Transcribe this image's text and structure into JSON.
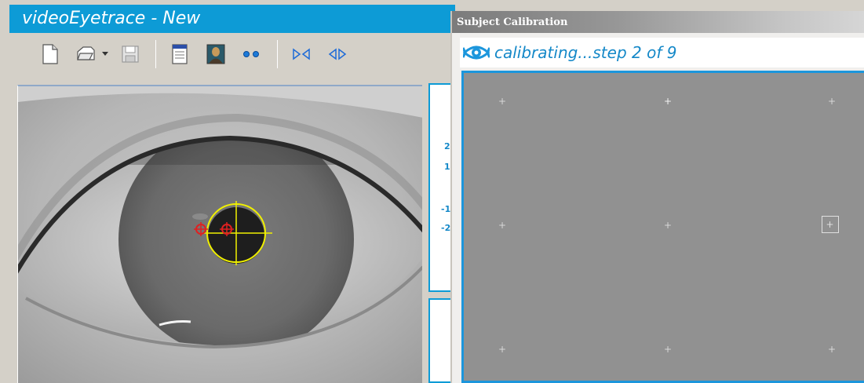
{
  "main_window": {
    "title": "videoEyetrace - New",
    "toolbar": {
      "buttons": [
        "new-file-icon",
        "open-file-icon",
        "dropdown-arrow-icon",
        "save-file-icon",
        "document-icon",
        "image-icon",
        "two-dots-icon",
        "narrow-icon",
        "widen-icon"
      ]
    },
    "side_axis": [
      "2",
      "1",
      "-1",
      "-2"
    ]
  },
  "calibration_window": {
    "title": "Subject Calibration",
    "status": "calibrating...step 2 of 9",
    "status_icon": "eye-icon",
    "grid": {
      "rows": 3,
      "cols": 3,
      "current_step": 2,
      "total_steps": 9
    }
  },
  "colors": {
    "title_blue": "#0d9bd6",
    "accent_blue": "#1488c8",
    "calibration_field": "#919191",
    "pupil_marker": "#f0f000",
    "glint_marker": "#e02020"
  }
}
